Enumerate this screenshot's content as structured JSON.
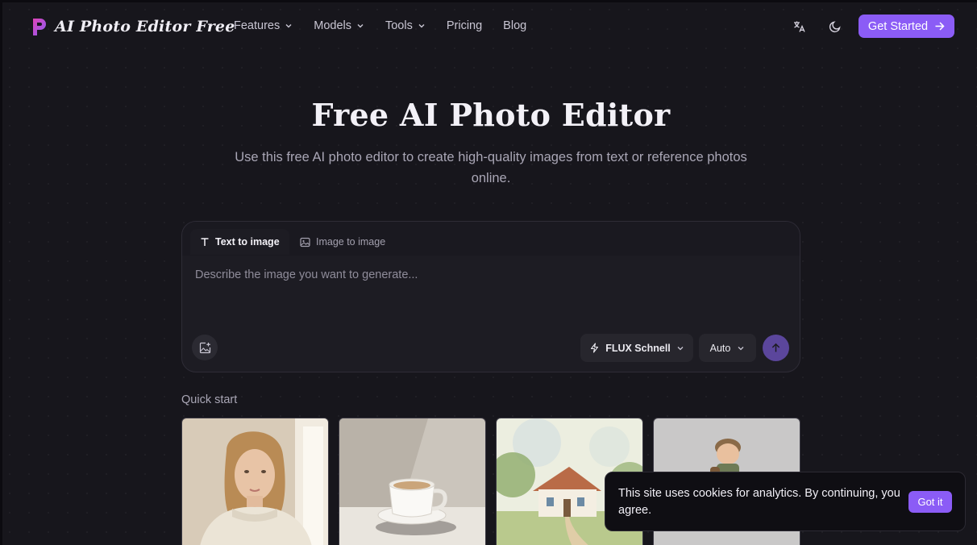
{
  "header": {
    "brand": "AI Photo Editor Free",
    "nav": [
      {
        "label": "Features",
        "dropdown": true
      },
      {
        "label": "Models",
        "dropdown": true
      },
      {
        "label": "Tools",
        "dropdown": true
      },
      {
        "label": "Pricing",
        "dropdown": false
      },
      {
        "label": "Blog",
        "dropdown": false
      }
    ],
    "translate_icon": "translate-icon",
    "theme_icon": "moon-icon",
    "cta_label": "Get Started"
  },
  "hero": {
    "title": "Free AI Photo Editor",
    "subtitle": "Use this free AI photo editor to create high-quality images from text or reference photos online."
  },
  "editor": {
    "tabs": [
      {
        "label": "Text to image",
        "active": true,
        "icon": "text-icon"
      },
      {
        "label": "Image to image",
        "active": false,
        "icon": "image-icon"
      }
    ],
    "prompt_placeholder": "Describe the image you want to generate...",
    "prompt_value": "",
    "model": "FLUX Schnell",
    "aspect": "Auto"
  },
  "quick_start": {
    "label": "Quick start",
    "items": [
      "portrait-woman",
      "coffee-cup",
      "watercolor-cottage",
      "toy-explorer"
    ]
  },
  "cookie": {
    "text": "This site uses cookies for analytics. By continuing, you agree.",
    "button": "Got it"
  },
  "colors": {
    "accent": "#8b5cf6",
    "background": "#17161c",
    "card": "#1d1c23"
  }
}
